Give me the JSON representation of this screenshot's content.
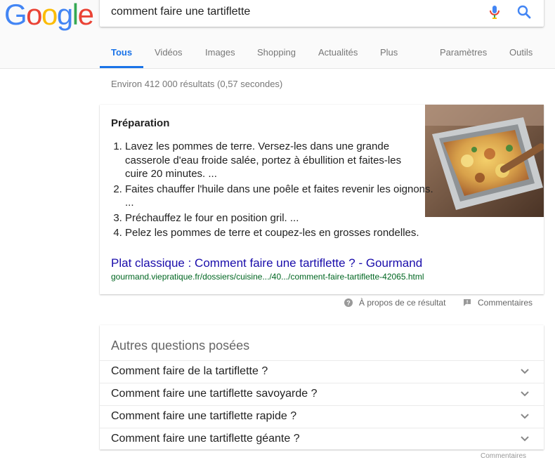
{
  "logo": {
    "text": "Google",
    "letters": [
      {
        "ch": "G",
        "color": "#4285F4"
      },
      {
        "ch": "o",
        "color": "#EA4335"
      },
      {
        "ch": "o",
        "color": "#FBBC05"
      },
      {
        "ch": "g",
        "color": "#4285F4"
      },
      {
        "ch": "l",
        "color": "#34A853"
      },
      {
        "ch": "e",
        "color": "#EA4335"
      }
    ]
  },
  "search": {
    "query": "comment faire une tartiflette"
  },
  "icons": {
    "mic": "microphone-icon",
    "search": "search-icon",
    "help": "help-circle-icon",
    "feedback": "feedback-flag-icon",
    "expand": "chevron-down-icon"
  },
  "tabs": [
    "Tous",
    "Vidéos",
    "Images",
    "Shopping",
    "Actualités",
    "Plus"
  ],
  "active_tab": "Tous",
  "tools": {
    "settings": "Paramètres",
    "tools": "Outils"
  },
  "results_stats": "Environ 412 000 résultats (0,57 secondes)",
  "featured": {
    "heading": "Préparation",
    "steps": [
      "Lavez les pommes de terre. Versez-les dans une grande casserole d'eau froide salée, portez à ébullition et faites-les cuire 20 minutes. ...",
      "Faites chauffer l'huile dans une poêle et faites revenir les oignons. ...",
      "Préchauffez le four en position gril. ...",
      "Pelez les pommes de terre et coupez-les en grosses rondelles."
    ],
    "link_title": "Plat classique : Comment faire une tartiflette ? - Gourmand",
    "link_url": "gourmand.viepratique.fr/dossiers/cuisine.../40.../comment-faire-tartiflette-42065.html"
  },
  "feedback": {
    "about": "À propos de ce résultat",
    "comments": "Commentaires"
  },
  "paa": {
    "title": "Autres questions posées",
    "questions": [
      "Comment faire de la tartiflette ?",
      "Comment faire une tartiflette savoyarde ?",
      "Comment faire une tartiflette rapide ?",
      "Comment faire une tartiflette géante ?"
    ]
  },
  "footer_fragment": "Commentaires",
  "colors": {
    "accent": "#1a73e8",
    "link": "#1a0dab",
    "url": "#006621"
  }
}
